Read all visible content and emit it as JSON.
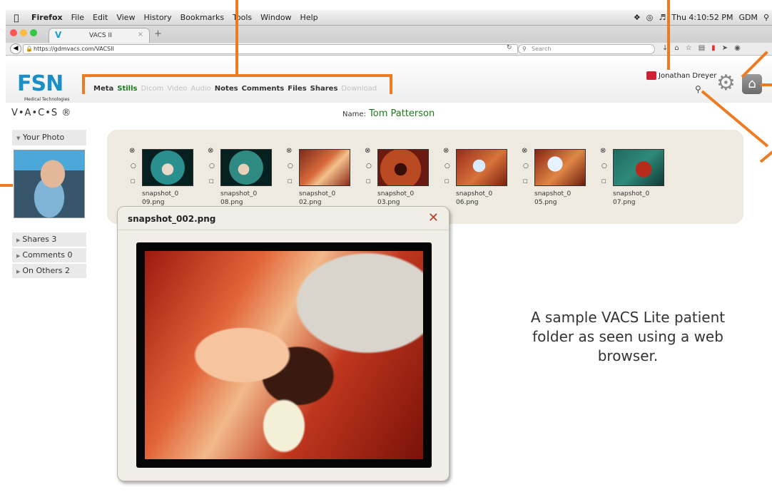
{
  "menubar": {
    "app": "Firefox",
    "items": [
      "File",
      "Edit",
      "View",
      "History",
      "Bookmarks",
      "Tools",
      "Window",
      "Help"
    ],
    "clock": "Thu 4:10:52 PM",
    "user": "GDM"
  },
  "browser": {
    "tab_title": "VACS II",
    "url": "https://gdmvacs.com/VACSII",
    "search_placeholder": "Search"
  },
  "app": {
    "logo_text": "FSN",
    "logo_sub": "Medical Technologies",
    "product": "V•A•C•S ®",
    "tabs": [
      {
        "label": "Meta",
        "state": "normal"
      },
      {
        "label": "Stills",
        "state": "active"
      },
      {
        "label": "Dicom",
        "state": "disabled"
      },
      {
        "label": "Video",
        "state": "disabled"
      },
      {
        "label": "Audio",
        "state": "disabled"
      },
      {
        "label": "Notes",
        "state": "normal"
      },
      {
        "label": "Comments",
        "state": "normal"
      },
      {
        "label": "Files",
        "state": "normal"
      },
      {
        "label": "Shares",
        "state": "normal"
      },
      {
        "label": "Download",
        "state": "disabled"
      }
    ],
    "user_name": "Jonathan Dreyer",
    "name_label": "Name:",
    "patient_name": "Tom Patterson"
  },
  "sidebar": {
    "photo_header": "Your Photo",
    "items": [
      "Shares 3",
      "Comments 0",
      "On Others 2"
    ]
  },
  "thumbnails": [
    {
      "name": "snapshot_0 09.png"
    },
    {
      "name": "snapshot_0 08.png"
    },
    {
      "name": "snapshot_0 02.png"
    },
    {
      "name": "snapshot_0 03.png"
    },
    {
      "name": "snapshot_0 06.png"
    },
    {
      "name": "snapshot_0 05.png"
    },
    {
      "name": "snapshot_0 07.png"
    }
  ],
  "popup": {
    "title": "snapshot_002.png",
    "close": "✕"
  },
  "caption": "A sample VACS Lite patient folder as seen using a web browser.",
  "colors": {
    "callout": "#ee7b22",
    "active_tab": "#1b7a1b",
    "brand": "#1c8fc7"
  }
}
